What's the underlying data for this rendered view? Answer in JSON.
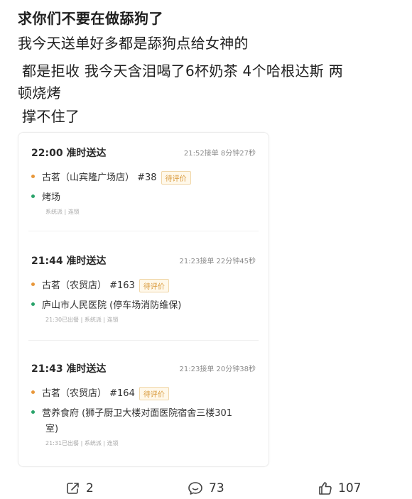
{
  "post": {
    "title": "求你们不要在做舔狗了",
    "lines": [
      "我今天送单好多都是舔狗点给女神的",
      "都是拒收 我今天含泪喝了6杯奶茶 4个哈根达斯 两",
      "顿烧烤",
      "撑不住了"
    ]
  },
  "orders": [
    {
      "time": "22:00 准时送达",
      "meta": "21:52接单 8分钟27秒",
      "store": "古茗（山宾隆广场店） #38",
      "badge": "待评价",
      "dest": "烤场",
      "sub": "系统派 | 连锁"
    },
    {
      "time": "21:44 准时送达",
      "meta": "21:23接单 22分钟45秒",
      "store": "古茗（农贸店） #163",
      "badge": "待评价",
      "dest": "庐山市人民医院 (停车场消防维保)",
      "sub": "21:30已出餐 | 系统派 | 连锁"
    },
    {
      "time": "21:43 准时送达",
      "meta": "21:23接单 20分钟38秒",
      "store": "古茗（农贸店） #164",
      "badge": "待评价",
      "dest": "营养食府 (狮子厨卫大楼对面医院宿舍三楼301",
      "dest_cont": "室)",
      "sub": "21:31已出餐 | 系统派 | 连锁"
    }
  ],
  "stats": {
    "share": "2",
    "comments": "73",
    "likes": "107"
  },
  "colors": {
    "store_dot": "#e8973a",
    "dest_dot": "#29a36a",
    "badge_text": "#d99a3c"
  },
  "icons": [
    "share-icon",
    "comment-icon",
    "like-icon"
  ]
}
